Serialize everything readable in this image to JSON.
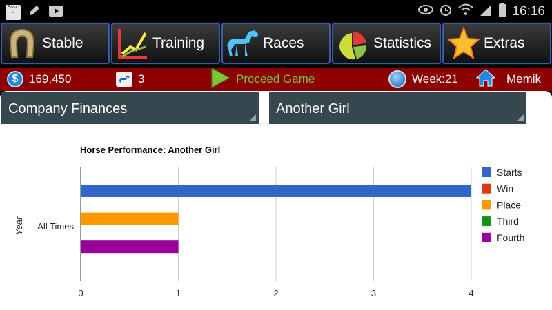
{
  "status_bar": {
    "time": "16:16"
  },
  "tabs": [
    {
      "label": "Stable",
      "icon": "horseshoe-icon"
    },
    {
      "label": "Training",
      "icon": "line-chart-icon"
    },
    {
      "label": "Races",
      "icon": "horse-icon"
    },
    {
      "label": "Statistics",
      "icon": "pie-chart-icon"
    },
    {
      "label": "Extras",
      "icon": "star-icon"
    }
  ],
  "info_bar": {
    "money": "169,450",
    "horses": "3",
    "proceed_label": "Proceed Game",
    "week": "Week:21",
    "user": "Memik"
  },
  "selectors": {
    "report": "Company Finances",
    "horse": "Another Girl"
  },
  "colors": {
    "header_red": "#8c0000",
    "tab_border": "#3d5aa8",
    "starts": "#3366cc",
    "win": "#dc3912",
    "place": "#ff9900",
    "third": "#109618",
    "fourth": "#990099"
  },
  "chart_data": {
    "type": "bar",
    "orientation": "horizontal",
    "title": "Horse Performance: Another Girl",
    "ylabel": "Year",
    "categories": [
      "All Times"
    ],
    "xlim": [
      0,
      4
    ],
    "xticks": [
      "0",
      "1",
      "2",
      "3",
      "4"
    ],
    "grid": true,
    "legend_position": "right",
    "series": [
      {
        "name": "Starts",
        "values": [
          4
        ]
      },
      {
        "name": "Win",
        "values": [
          0
        ]
      },
      {
        "name": "Place",
        "values": [
          1
        ]
      },
      {
        "name": "Third",
        "values": [
          0
        ]
      },
      {
        "name": "Fourth",
        "values": [
          1
        ]
      }
    ]
  }
}
